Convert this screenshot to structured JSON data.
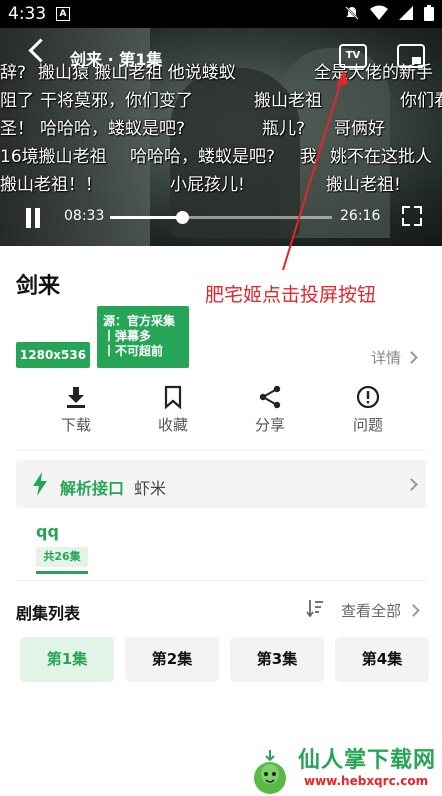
{
  "status_bar": {
    "time": "4:33",
    "badge": "A"
  },
  "player": {
    "title": "剑来 · 第1集",
    "tv_label": "TV",
    "current_time": "08:33",
    "duration": "26:16",
    "progress": 0.326,
    "danmaku": [
      "辞?",
      "搬山猿 搬山老祖 他说蝼蚁",
      "全是大佬的新手",
      "阻了",
      "干将莫邪，你们变了",
      "搬山老祖",
      "你们看",
      "圣！",
      "哈哈哈，蝼蚁是吧?",
      "瓶儿?",
      "哥俩好",
      "16境搬山老祖",
      "哈哈哈，蝼蚁是吧?",
      "我",
      "姚不在这批人",
      "搬山老祖！！",
      "小屁孩儿!",
      "搬山老祖!"
    ]
  },
  "show": {
    "title": "剑来",
    "annotation": "肥宅姬点击投屏按钮",
    "resolution": "1280x536",
    "source_lines": [
      "源：官方采集",
      "丨弹幕多",
      "丨不可超前"
    ],
    "details_label": "详情"
  },
  "actions": [
    {
      "label": "下载",
      "icon": "download-icon"
    },
    {
      "label": "收藏",
      "icon": "bookmark-icon"
    },
    {
      "label": "分享",
      "icon": "share-icon"
    },
    {
      "label": "问题",
      "icon": "alert-icon"
    }
  ],
  "api": {
    "label": "解析接口",
    "value": "虾米"
  },
  "source_tab": {
    "name": "qq",
    "count": "共26集"
  },
  "episode_list": {
    "title": "剧集列表",
    "view_all": "查看全部",
    "episodes": [
      "第1集",
      "第2集",
      "第3集",
      "第4集"
    ],
    "active_index": 0
  },
  "watermark": {
    "name": "仙人掌下载网",
    "url": "www.hebxqrc.com"
  },
  "colors": {
    "accent": "#27a557",
    "annotation": "#e8242b"
  }
}
